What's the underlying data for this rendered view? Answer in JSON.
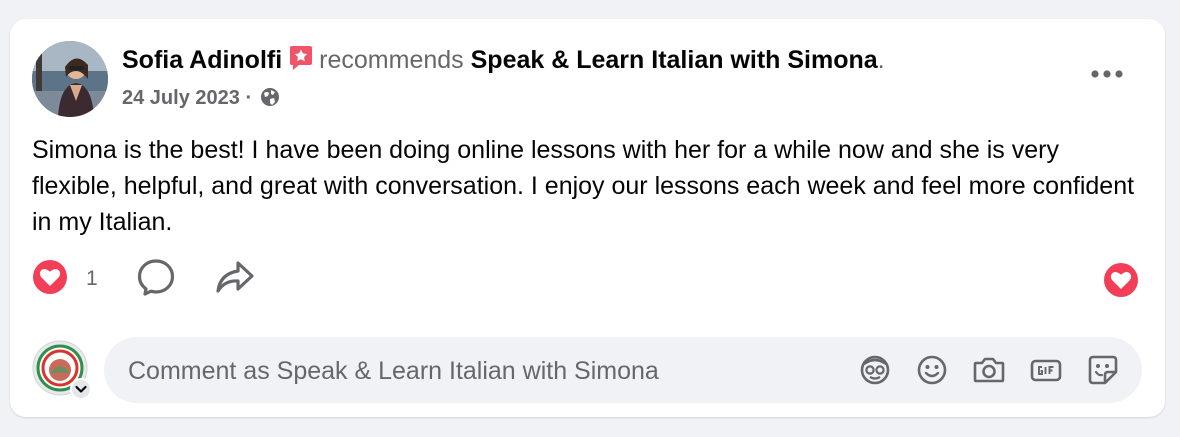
{
  "post": {
    "author": "Sofia Adinolfi",
    "recommends_word": "recommends",
    "page_name": "Speak & Learn Italian with Simona",
    "page_suffix": ".",
    "date": "24 July 2023",
    "date_separator": "·",
    "privacy_icon": "globe-icon",
    "body": "Simona is the best! I have been doing online lessons with her for a while now and she is very flexible, helpful, and great with conversation. I enjoy our lessons each week and feel more confident in my Italian.",
    "more_icon": "more-horizontal-icon"
  },
  "reactions": {
    "icon": "love-reaction-icon",
    "count": "1",
    "comment_icon": "comment-icon",
    "share_icon": "share-icon",
    "right_icon": "love-reaction-icon"
  },
  "comment": {
    "placeholder": "Comment as Speak & Learn Italian with Simona",
    "value": "",
    "tools": [
      "avatar-sticker-icon",
      "emoji-icon",
      "camera-icon",
      "gif-icon",
      "sticker-icon"
    ]
  },
  "colors": {
    "background": "#f0f2f5",
    "card": "#ffffff",
    "text_primary": "#050505",
    "text_secondary": "#65676b",
    "love_red": "#f33e58",
    "recommend_badge": "#f35369"
  }
}
